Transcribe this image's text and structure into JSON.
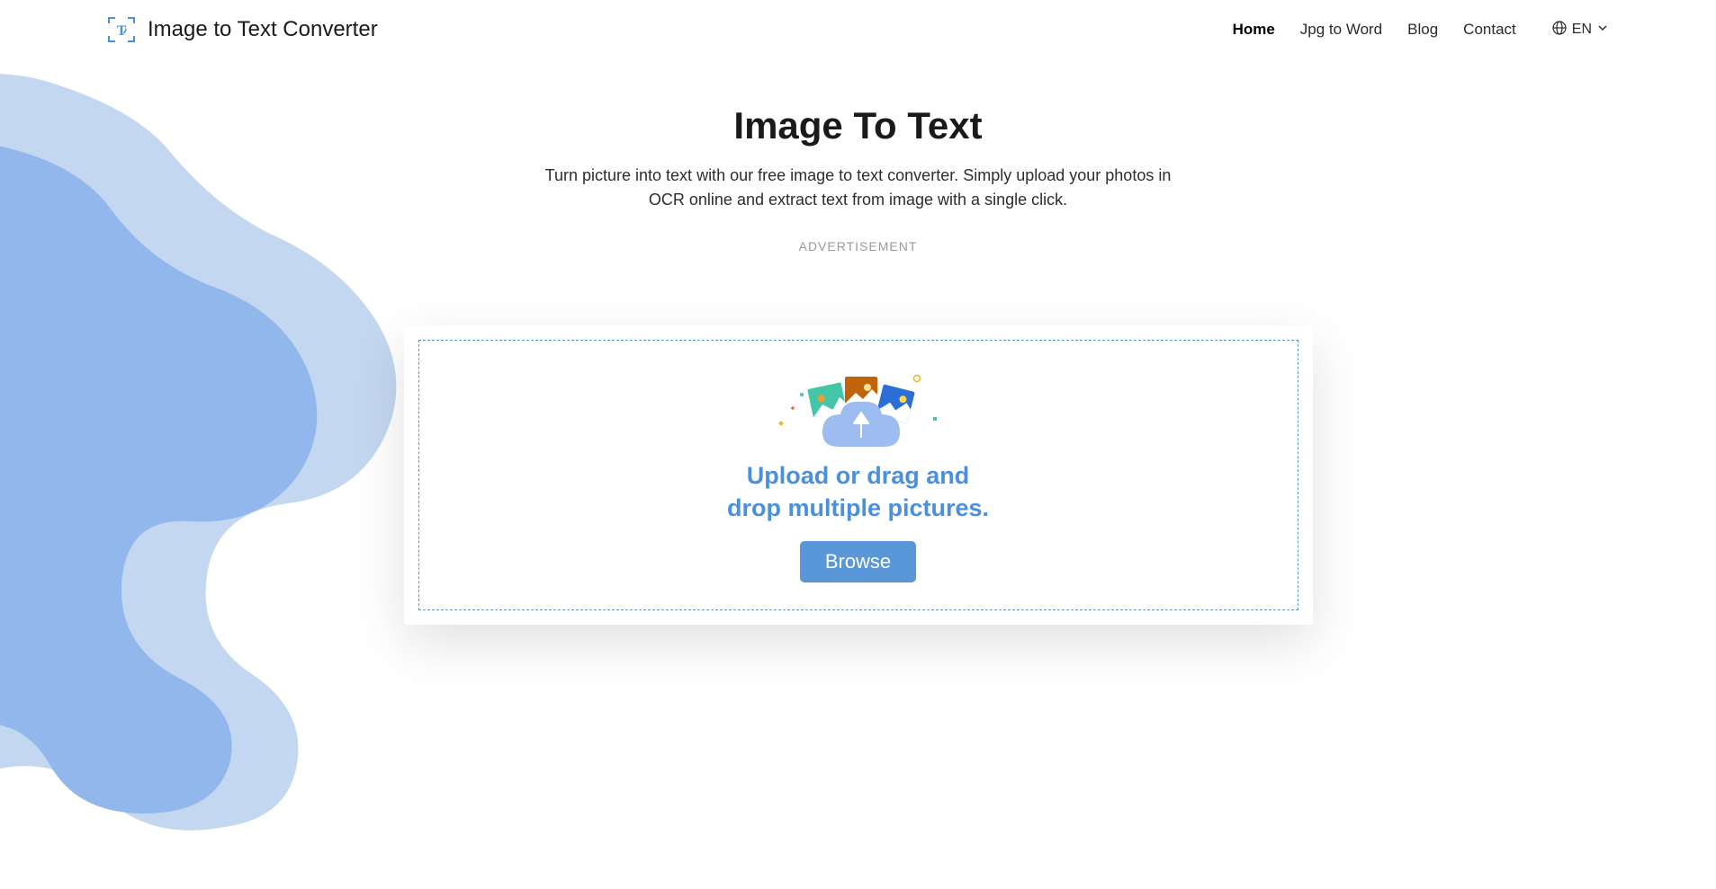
{
  "header": {
    "brand": "Image to Text Converter",
    "nav": [
      {
        "label": "Home",
        "active": true
      },
      {
        "label": "Jpg to Word",
        "active": false
      },
      {
        "label": "Blog",
        "active": false
      },
      {
        "label": "Contact",
        "active": false
      }
    ],
    "lang": "EN"
  },
  "main": {
    "title": "Image To Text",
    "description": "Turn picture into text with our free image to text converter. Simply upload your photos in OCR online and extract text from image with a single click.",
    "ad_label": "ADVERTISEMENT",
    "drop_text": "Upload or drag and drop multiple pictures.",
    "browse_label": "Browse"
  }
}
